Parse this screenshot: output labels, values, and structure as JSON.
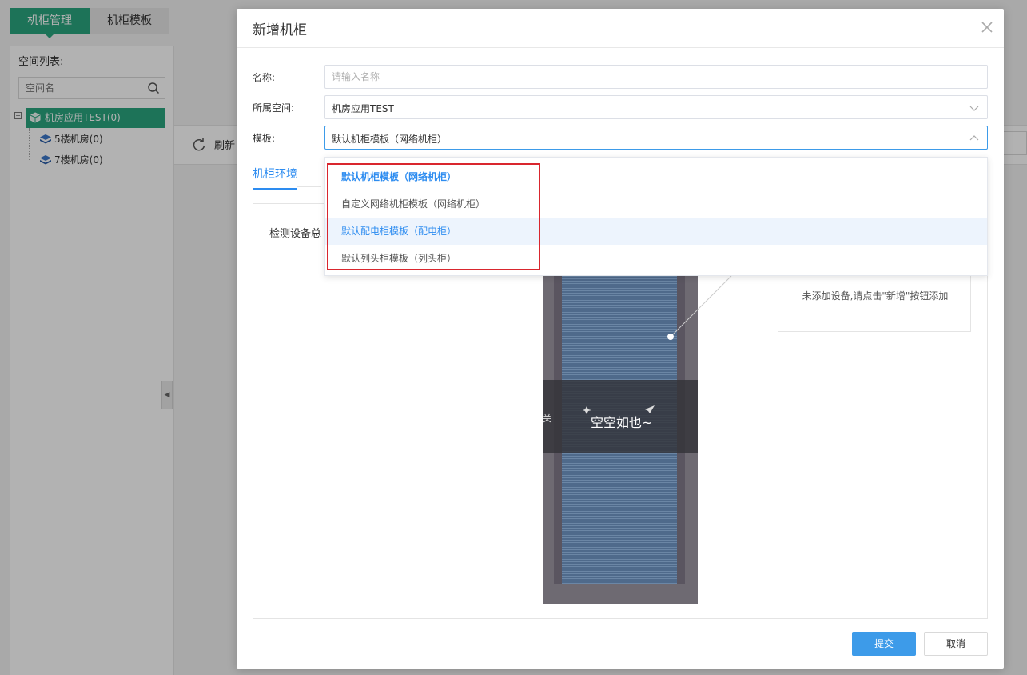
{
  "top_tabs": [
    {
      "label": "机柜管理"
    },
    {
      "label": "机柜模板"
    }
  ],
  "sidebar": {
    "title": "空间列表:",
    "search_placeholder": "空间名",
    "tree_root": "机房应用TEST(0)",
    "tree_children": [
      "5楼机房(0)",
      "7楼机房(0)"
    ]
  },
  "toolbar": {
    "refresh_label": "刷新"
  },
  "modal": {
    "title": "新增机柜",
    "name_label": "名称:",
    "name_placeholder": "请输入名称",
    "space_label": "所属空间:",
    "space_value": "机房应用TEST",
    "template_label": "模板:",
    "template_value": "默认机柜模板（网络机柜）",
    "tab_label": "机柜环境",
    "monitor_label": "检测设备总",
    "empty_text": "空空如也~",
    "side_tab_text": "关",
    "info_text": "未添加设备,请点击\"新增\"按钮添加",
    "submit_label": "提交",
    "cancel_label": "取消"
  },
  "dropdown": {
    "options": [
      {
        "label": "默认机柜模板（网络机柜）",
        "state": "selected"
      },
      {
        "label": "自定义网络机柜模板（网络机柜）",
        "state": "normal"
      },
      {
        "label": "默认配电柜模板（配电柜）",
        "state": "hovered"
      },
      {
        "label": "默认列头柜模板（列头柜）",
        "state": "normal"
      }
    ]
  },
  "colors": {
    "brand_green": "#2aa57f",
    "primary_blue": "#3d9be9",
    "highlight_red": "#d9262e"
  },
  "icons": [
    "search-icon",
    "cube-icon",
    "layer-icon",
    "refresh-icon",
    "close-icon",
    "chevron-down-icon",
    "chevron-up-icon",
    "collapse-left-icon"
  ]
}
